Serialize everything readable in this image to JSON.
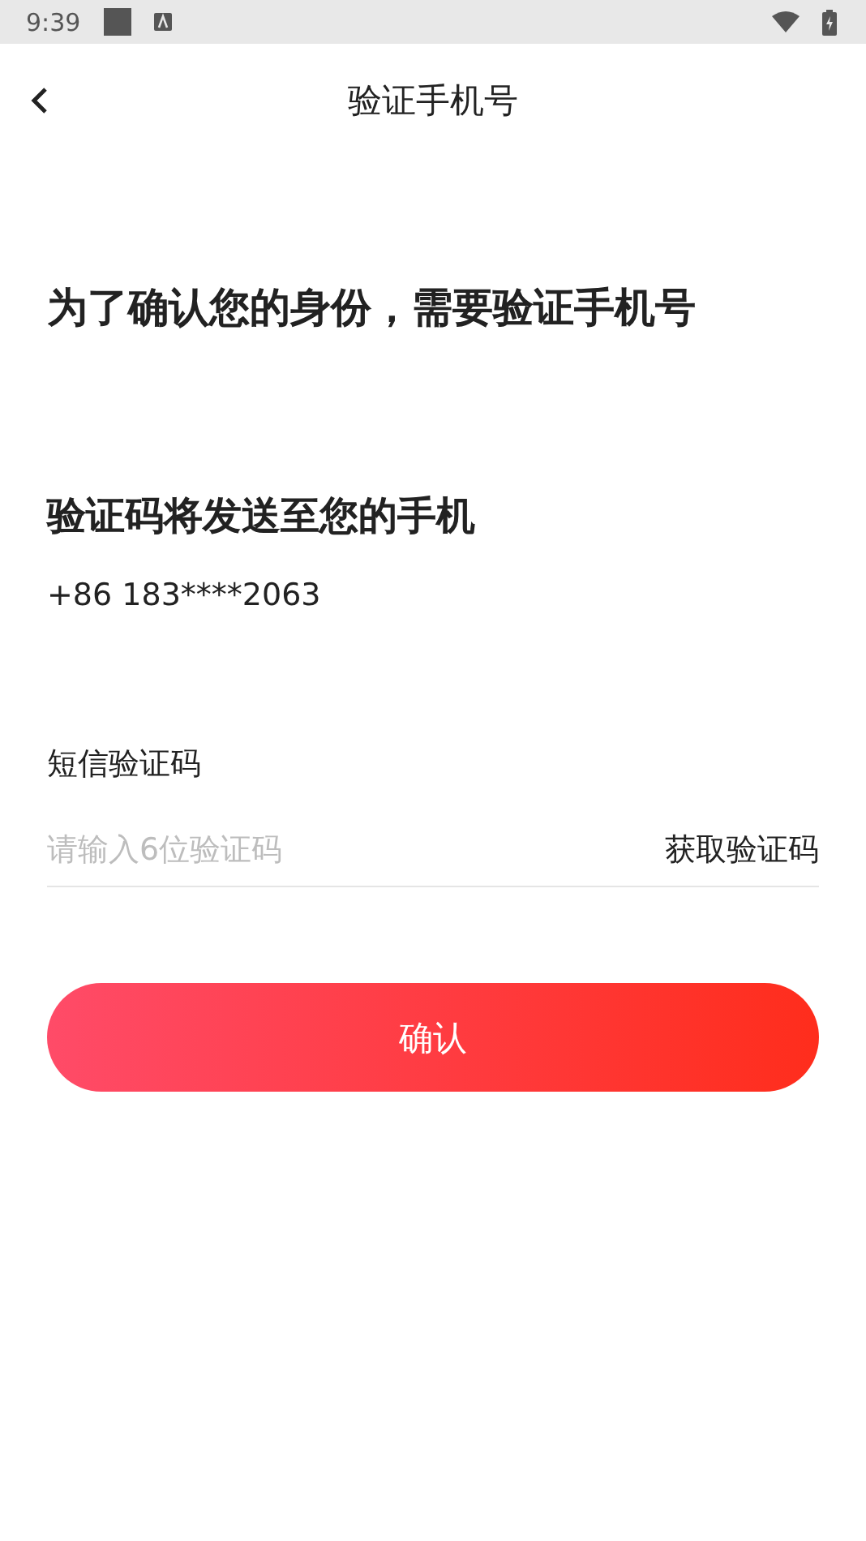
{
  "status_bar": {
    "time": "9:39"
  },
  "header": {
    "title": "验证手机号"
  },
  "headline": "为了确认您的身份，需要验证手机号",
  "subheading": "验证码将发送至您的手机",
  "phone": "+86 183****2063",
  "code_field": {
    "label": "短信验证码",
    "placeholder": "请输入6位验证码",
    "action": "获取验证码"
  },
  "confirm_button": "确认"
}
